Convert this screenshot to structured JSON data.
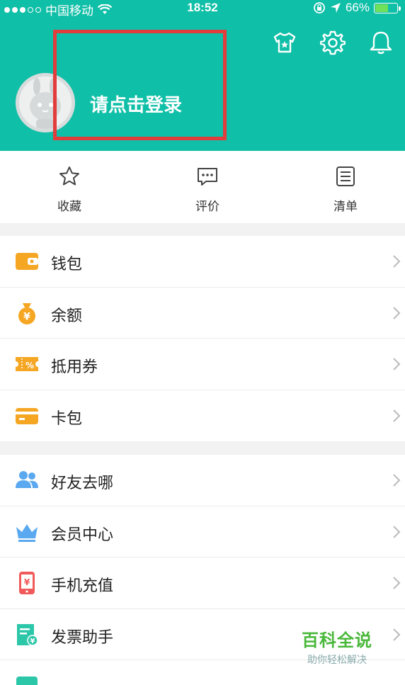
{
  "status": {
    "carrier": "中国移动",
    "time": "18:52",
    "battery_pct": "66%",
    "battery_level": 0.66
  },
  "header": {
    "login_text": "请点击登录",
    "icons": [
      "tshirt-icon",
      "gear-icon",
      "bell-icon"
    ]
  },
  "quick_actions": [
    {
      "label": "收藏",
      "icon": "star-icon"
    },
    {
      "label": "评价",
      "icon": "comment-icon"
    },
    {
      "label": "清单",
      "icon": "list-icon"
    }
  ],
  "group1": [
    {
      "label": "钱包",
      "icon": "wallet-icon",
      "color": "#f5a623"
    },
    {
      "label": "余额",
      "icon": "money-bag-icon",
      "color": "#f5a623"
    },
    {
      "label": "抵用券",
      "icon": "coupon-icon",
      "color": "#f5a623"
    },
    {
      "label": "卡包",
      "icon": "card-icon",
      "color": "#f5a623"
    }
  ],
  "group2": [
    {
      "label": "好友去哪",
      "icon": "friends-icon",
      "color": "#5aa9f0"
    },
    {
      "label": "会员中心",
      "icon": "crown-icon",
      "color": "#5aa9f0"
    },
    {
      "label": "手机充值",
      "icon": "phone-recharge-icon",
      "color": "#f05a5a"
    },
    {
      "label": "发票助手",
      "icon": "invoice-icon",
      "color": "#2cc7a9"
    },
    {
      "label": "",
      "icon": "partial-icon",
      "color": "#2cc7a9"
    }
  ],
  "watermark": {
    "title": "百科全说",
    "subtitle": "助你轻松解决"
  },
  "colors": {
    "header": "#0fbfa7",
    "highlight": "#e23c3c"
  }
}
